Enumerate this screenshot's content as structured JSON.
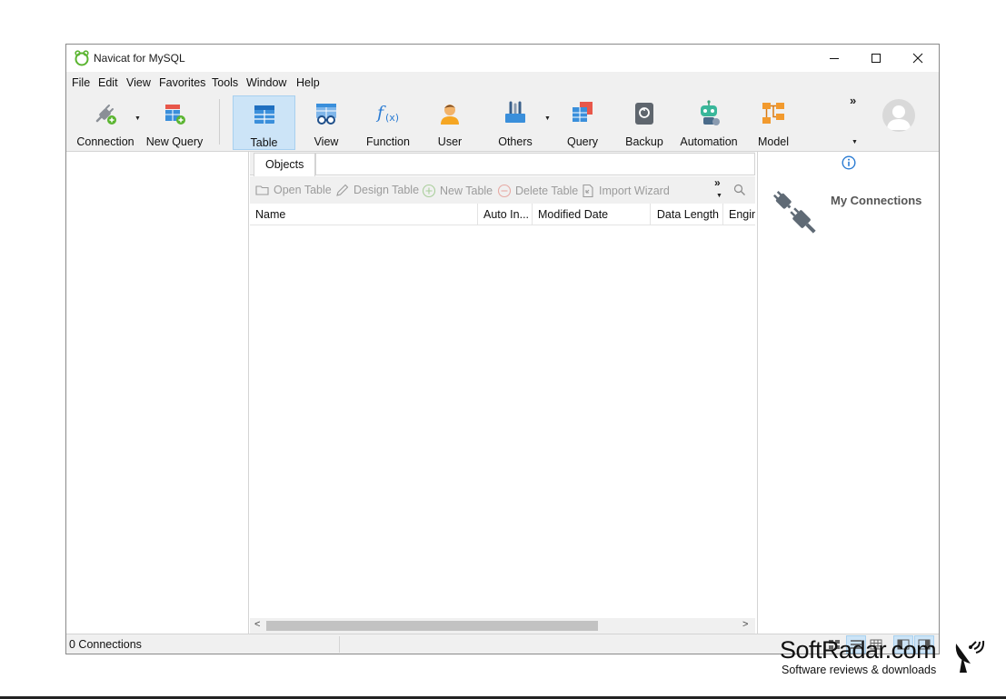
{
  "window": {
    "title": "Navicat for MySQL"
  },
  "menu": [
    "File",
    "Edit",
    "View",
    "Favorites",
    "Tools",
    "Window",
    "Help"
  ],
  "toolbar": {
    "connection": "Connection",
    "new_query": "New Query",
    "table": "Table",
    "view": "View",
    "function": "Function",
    "user": "User",
    "others": "Others",
    "query": "Query",
    "backup": "Backup",
    "automation": "Automation",
    "model": "Model"
  },
  "tabs": {
    "objects": "Objects"
  },
  "object_actions": {
    "open_table": "Open Table",
    "design_table": "Design Table",
    "new_table": "New Table",
    "delete_table": "Delete Table",
    "import_wizard": "Import Wizard"
  },
  "columns": [
    "Name",
    "Auto In...",
    "Modified Date",
    "Data Length",
    "Engin"
  ],
  "right_panel": {
    "heading": "My Connections"
  },
  "status": {
    "connections": "0 Connections"
  },
  "watermark": {
    "title": "SoftRadar.com",
    "subtitle": "Software reviews & downloads"
  },
  "colors": {
    "active_tool": "#cce4f7",
    "accent_blue": "#2b7cd3",
    "navicat_green": "#5bb531"
  }
}
